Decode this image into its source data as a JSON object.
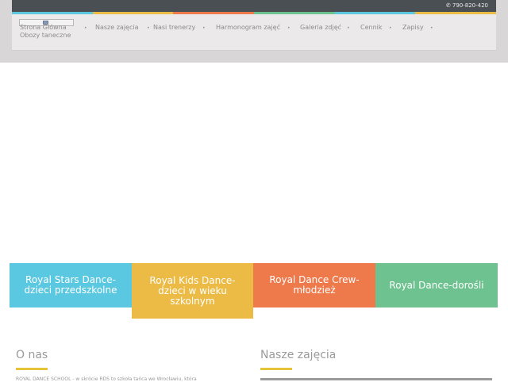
{
  "header": {
    "phone": "790-820-420",
    "stripe_colors": [
      "#5bc8df",
      "#eabb45",
      "#ee7a4b",
      "#6cc28f",
      "#5bc8df",
      "#eabb45"
    ]
  },
  "nav": {
    "items": [
      {
        "label": "Strona Główna"
      },
      {
        "label": "Nasze zajęcia"
      },
      {
        "label": "Nasi trenerzy"
      },
      {
        "label": "Harmonogram zajęć"
      },
      {
        "label": "Galeria zdjęć"
      },
      {
        "label": "Cennik"
      },
      {
        "label": "Zapisy"
      },
      {
        "label": "Obozy taneczne"
      }
    ],
    "separator": "•"
  },
  "tiles": [
    {
      "label": "Royal Stars Dance-dzieci przedszkolne",
      "color": "#5bc8e1"
    },
    {
      "label": "Royal Kids Dance-dzieci w wieku szkolnym",
      "color": "#ebbb46"
    },
    {
      "label": "Royal Dance Crew-młodzież",
      "color": "#ee7a4c"
    },
    {
      "label": "Royal Dance-dorośli",
      "color": "#6dc290"
    }
  ],
  "sections": {
    "about_title": "O nas",
    "classes_title": "Nasze zajęcia",
    "about_text": "ROYAL DANCE SCHOOL - w skrócie RDS to szkoła tańca we Wrocławiu, która",
    "accent_color": "#e5c43a"
  }
}
